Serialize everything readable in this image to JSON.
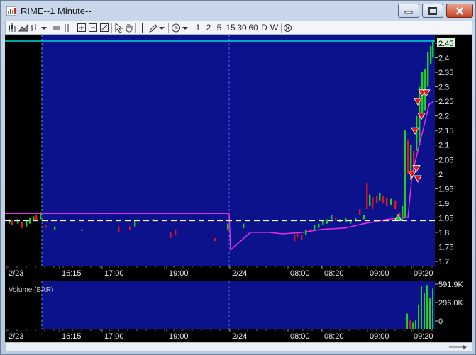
{
  "window": {
    "title": "RIME--1 Minute--"
  },
  "toolbar": {
    "periods": [
      "1",
      "2",
      "5",
      "15",
      "30",
      "60",
      "D",
      "W"
    ]
  },
  "price_panel": {
    "y_ticks": [
      "2.45",
      "2.4",
      "2.35",
      "2.3",
      "2.25",
      "2.2",
      "2.15",
      "2.1",
      "2.05",
      "2",
      "1.95",
      "1.9",
      "1.85",
      "1.8",
      "1.75",
      "1.7"
    ],
    "x_ticks": [
      "2/23",
      "16:15",
      "17:00",
      "19:00",
      "2/24",
      "08:00",
      "08:20",
      "09:00",
      "09:20"
    ]
  },
  "volume_panel": {
    "label": "Volume (BAR)",
    "y_ticks": [
      "591.9K",
      "296.0K",
      "0"
    ],
    "x_ticks": [
      "2/23",
      "16:15",
      "17:00",
      "19:00",
      "2/24",
      "08:00",
      "08:20",
      "09:00",
      "09:20"
    ]
  },
  "colors": {
    "plot_bg": "#0b128c",
    "up": "#1fcf1f",
    "down": "#e01616",
    "vwap": "#e62de6",
    "hline": "#00d8d8",
    "dash": "#ffffff"
  },
  "chart_data": {
    "type": "candlestick",
    "last_price": 2.45,
    "reference_price_line": 2.45,
    "dashed_level": 1.84,
    "ylim": [
      1.7,
      2.45
    ],
    "vwap_start": 1.865,
    "vwap_end": 2.25,
    "volume_ylim": [
      0,
      591900
    ]
  }
}
